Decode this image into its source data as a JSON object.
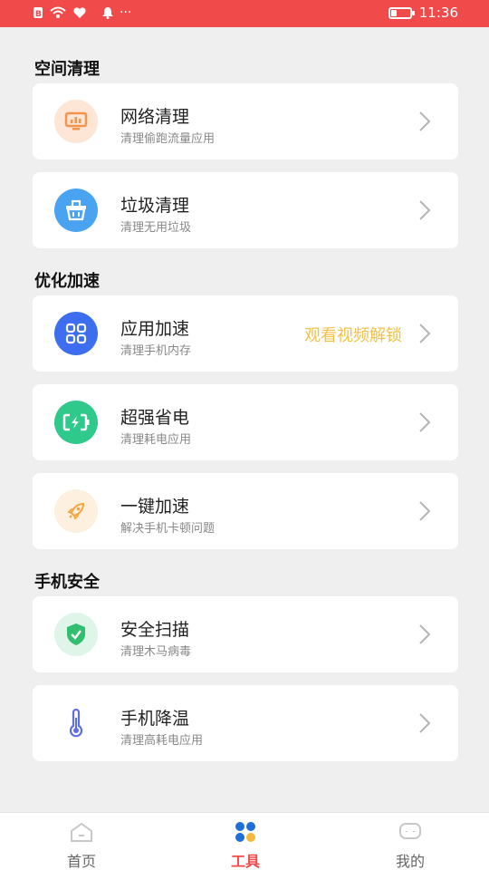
{
  "status_bar": {
    "time": "11:36",
    "dots": "···"
  },
  "sections": [
    {
      "title": "空间清理"
    },
    {
      "title": "优化加速"
    },
    {
      "title": "手机安全"
    }
  ],
  "cards": [
    {
      "title": "网络清理",
      "subtitle": "清理偷跑流量应用",
      "icon": "monitor-icon",
      "icon_bg": "#fde6d6",
      "icon_color": "#f4944b"
    },
    {
      "title": "垃圾清理",
      "subtitle": "清理无用垃圾",
      "icon": "trash-basket-icon",
      "icon_bg": "#4aa3f0",
      "icon_color": "#ffffff"
    },
    {
      "title": "应用加速",
      "subtitle": "清理手机内存",
      "icon": "apps-grid-icon",
      "icon_bg": "#3d6ef0",
      "icon_color": "#ffffff",
      "badge": "观看视频解锁"
    },
    {
      "title": "超强省电",
      "subtitle": "清理耗电应用",
      "icon": "battery-charge-icon",
      "icon_bg": "#2fc98c",
      "icon_color": "#ffffff"
    },
    {
      "title": "一键加速",
      "subtitle": "解决手机卡顿问题",
      "icon": "rocket-icon",
      "icon_bg": "#fdf0df",
      "icon_color": "#f3a53f"
    },
    {
      "title": "安全扫描",
      "subtitle": "清理木马病毒",
      "icon": "shield-check-icon",
      "icon_bg": "#dff5e8",
      "icon_color": "#2fbf6f"
    },
    {
      "title": "手机降温",
      "subtitle": "清理高耗电应用",
      "icon": "thermometer-icon",
      "icon_bg": "#ffffff",
      "icon_color": "#5e6fe6"
    }
  ],
  "bottom_nav": [
    {
      "label": "首页",
      "icon": "home-icon"
    },
    {
      "label": "工具",
      "icon": "tools-icon",
      "active": true
    },
    {
      "label": "我的",
      "icon": "profile-icon"
    }
  ],
  "colors": {
    "accent": "#f04a4a",
    "unlock": "#f1c14a",
    "background": "#efefef"
  }
}
